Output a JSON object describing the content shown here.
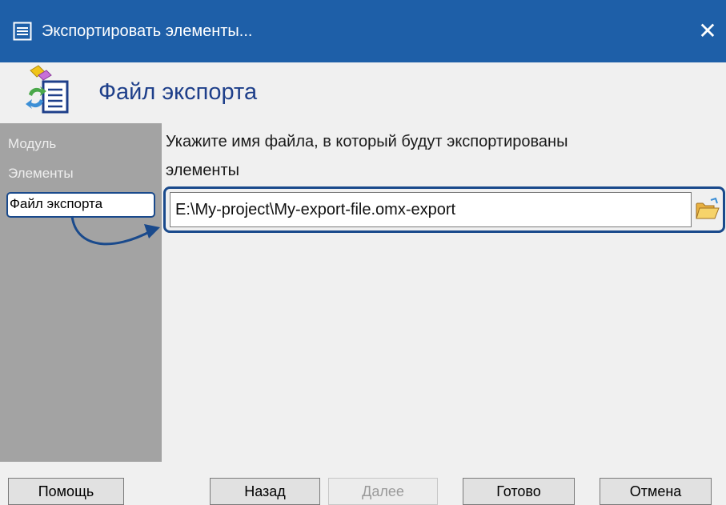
{
  "window": {
    "title": "Экспортировать элементы...",
    "close_symbol": "✕"
  },
  "header": {
    "title": "Файл экспорта"
  },
  "sidebar": {
    "items": [
      {
        "label": "Модуль"
      },
      {
        "label": "Элементы"
      },
      {
        "label": "Файл экспорта",
        "selected": true
      }
    ]
  },
  "main": {
    "instruction_line1": "Укажите имя файла, в который будут экспортированы",
    "instruction_line2": "элементы",
    "file_path": "E:\\My-project\\My-export-file.omx-export"
  },
  "buttons": {
    "help": "Помощь",
    "back": "Назад",
    "next": "Далее",
    "finish": "Готово",
    "cancel": "Отмена"
  },
  "icons": {
    "title": "window-icon",
    "header": "export-file-icon",
    "browse": "folder-open-icon"
  },
  "colors": {
    "titlebar": "#1e5fa8",
    "accent": "#1a4a8c",
    "sidebar": "#a3a3a3",
    "header_title": "#1e3f8a"
  }
}
